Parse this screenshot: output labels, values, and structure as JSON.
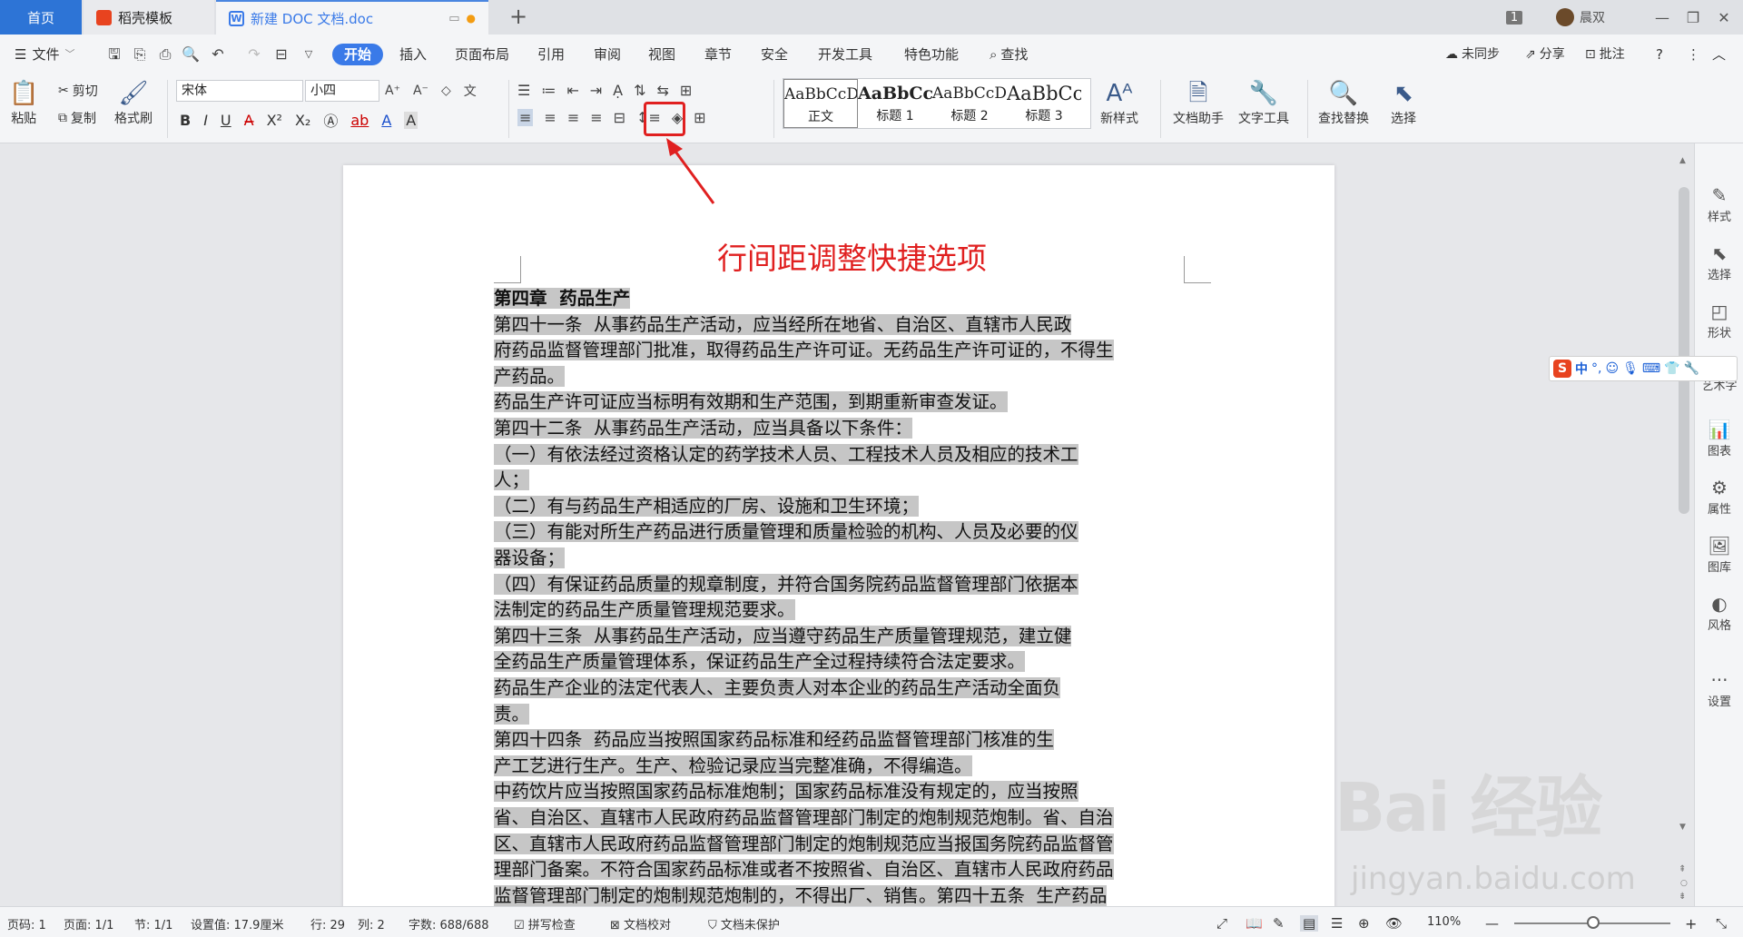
{
  "tabs": {
    "home": "首页",
    "template": "稻壳模板",
    "doc": "新建 DOC 文档.doc",
    "add": "+"
  },
  "title_right": {
    "badge": "1",
    "user": "晨双"
  },
  "menu": {
    "file": "文件",
    "start": "开始",
    "items": [
      "插入",
      "页面布局",
      "引用",
      "审阅",
      "视图",
      "章节",
      "安全",
      "开发工具",
      "特色功能"
    ],
    "search": "查找",
    "sync": "未同步",
    "share": "分享",
    "comment": "批注"
  },
  "ribbon": {
    "paste": "粘贴",
    "cut": "剪切",
    "copy": "复制",
    "format_painter": "格式刷",
    "font_name": "宋体",
    "font_size": "小四",
    "styles": [
      {
        "preview": "AaBbCcDd",
        "name": "正文"
      },
      {
        "preview": "AaBbCcI",
        "name": "标题 1"
      },
      {
        "preview": "AaBbCcDd",
        "name": "标题 2"
      },
      {
        "preview": "AaBbCc",
        "name": "标题 3"
      }
    ],
    "new_style": "新样式",
    "doc_assistant": "文档助手",
    "text_tools": "文字工具",
    "find_replace": "查找替换",
    "select": "选择"
  },
  "annotation": "行间距调整快捷选项",
  "document": {
    "lines": [
      "第四章  药品生产",
      "第四十一条  从事药品生产活动，应当经所在地省、自治区、直辖市人民政",
      "府药品监督管理部门批准，取得药品生产许可证。无药品生产许可证的，不得生",
      "产药品。",
      "药品生产许可证应当标明有效期和生产范围，到期重新审查发证。",
      "第四十二条  从事药品生产活动，应当具备以下条件：",
      "（一）有依法经过资格认定的药学技术人员、工程技术人员及相应的技术工",
      "人；",
      "（二）有与药品生产相适应的厂房、设施和卫生环境；",
      "（三）有能对所生产药品进行质量管理和质量检验的机构、人员及必要的仪",
      "器设备；",
      "（四）有保证药品质量的规章制度，并符合国务院药品监督管理部门依据本",
      "法制定的药品生产质量管理规范要求。",
      "第四十三条  从事药品生产活动，应当遵守药品生产质量管理规范，建立健",
      "全药品生产质量管理体系，保证药品生产全过程持续符合法定要求。",
      "药品生产企业的法定代表人、主要负责人对本企业的药品生产活动全面负",
      "责。",
      "第四十四条  药品应当按照国家药品标准和经药品监督管理部门核准的生",
      "产工艺进行生产。生产、检验记录应当完整准确，不得编造。",
      "中药饮片应当按照国家药品标准炮制；国家药品标准没有规定的，应当按照",
      "省、自治区、直辖市人民政府药品监督管理部门制定的炮制规范炮制。省、自治",
      "区、直辖市人民政府药品监督管理部门制定的炮制规范应当报国务院药品监督管",
      "理部门备案。不符合国家药品标准或者不按照省、自治区、直辖市人民政府药品",
      "监督管理部门制定的炮制规范炮制的，不得出厂、销售。第四十五条  生产药品"
    ]
  },
  "right_panel": [
    "样式",
    "选择",
    "形状",
    "艺术字",
    "图表",
    "属性",
    "图库",
    "风格",
    "设置"
  ],
  "ime": {
    "logo": "S",
    "mode": "中"
  },
  "status": {
    "page": "页码: 1",
    "pages": "页面: 1/1",
    "section": "节: 1/1",
    "setting": "设置值: 17.9厘米",
    "row": "行: 29",
    "col": "列: 2",
    "words": "字数: 688/688",
    "spell": "拼写检查",
    "proof": "文档校对",
    "protect": "文档未保护",
    "zoom": "110%"
  },
  "watermark": {
    "logo": "Bai  经验",
    "url": "jingyan.baidu.com"
  },
  "colors": {
    "accent": "#3a7ae8",
    "annotation": "#e02020",
    "selection": "#c6c6c6"
  }
}
